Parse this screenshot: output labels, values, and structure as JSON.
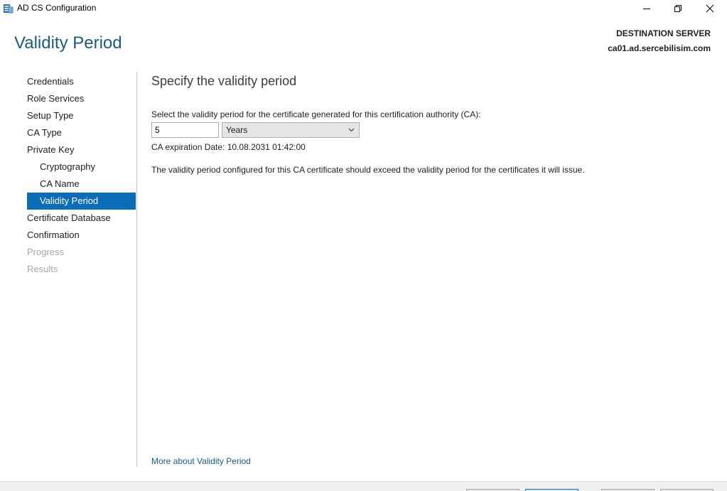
{
  "window": {
    "title": "AD CS Configuration",
    "icons": {
      "app": "server-manager-icon",
      "minimize": "minimize-icon",
      "maximize": "restore-icon",
      "close": "close-icon"
    }
  },
  "header": {
    "page_title": "Validity Period",
    "destination_label": "DESTINATION SERVER",
    "destination_server": "ca01.ad.sercebilisim.com"
  },
  "nav": {
    "items": [
      {
        "label": "Credentials",
        "level": 0,
        "state": "normal"
      },
      {
        "label": "Role Services",
        "level": 0,
        "state": "normal"
      },
      {
        "label": "Setup Type",
        "level": 0,
        "state": "normal"
      },
      {
        "label": "CA Type",
        "level": 0,
        "state": "normal"
      },
      {
        "label": "Private Key",
        "level": 0,
        "state": "normal"
      },
      {
        "label": "Cryptography",
        "level": 1,
        "state": "normal"
      },
      {
        "label": "CA Name",
        "level": 1,
        "state": "normal"
      },
      {
        "label": "Validity Period",
        "level": 1,
        "state": "active"
      },
      {
        "label": "Certificate Database",
        "level": 0,
        "state": "normal"
      },
      {
        "label": "Confirmation",
        "level": 0,
        "state": "normal"
      },
      {
        "label": "Progress",
        "level": 0,
        "state": "disabled"
      },
      {
        "label": "Results",
        "level": 0,
        "state": "disabled"
      }
    ]
  },
  "content": {
    "heading": "Specify the validity period",
    "prompt": "Select the validity period for the certificate generated for this certification authority (CA):",
    "period_value": "5",
    "period_unit": "Years",
    "expiration": "CA expiration Date: 10.08.2031 01:42:00",
    "note": "The validity period configured for this CA certificate should exceed the validity period for the certificates it will issue.",
    "more_link": "More about Validity Period"
  },
  "colors": {
    "accent": "#0b6cb8",
    "title": "#1a5b86",
    "disabled": "#a7a7a7"
  }
}
